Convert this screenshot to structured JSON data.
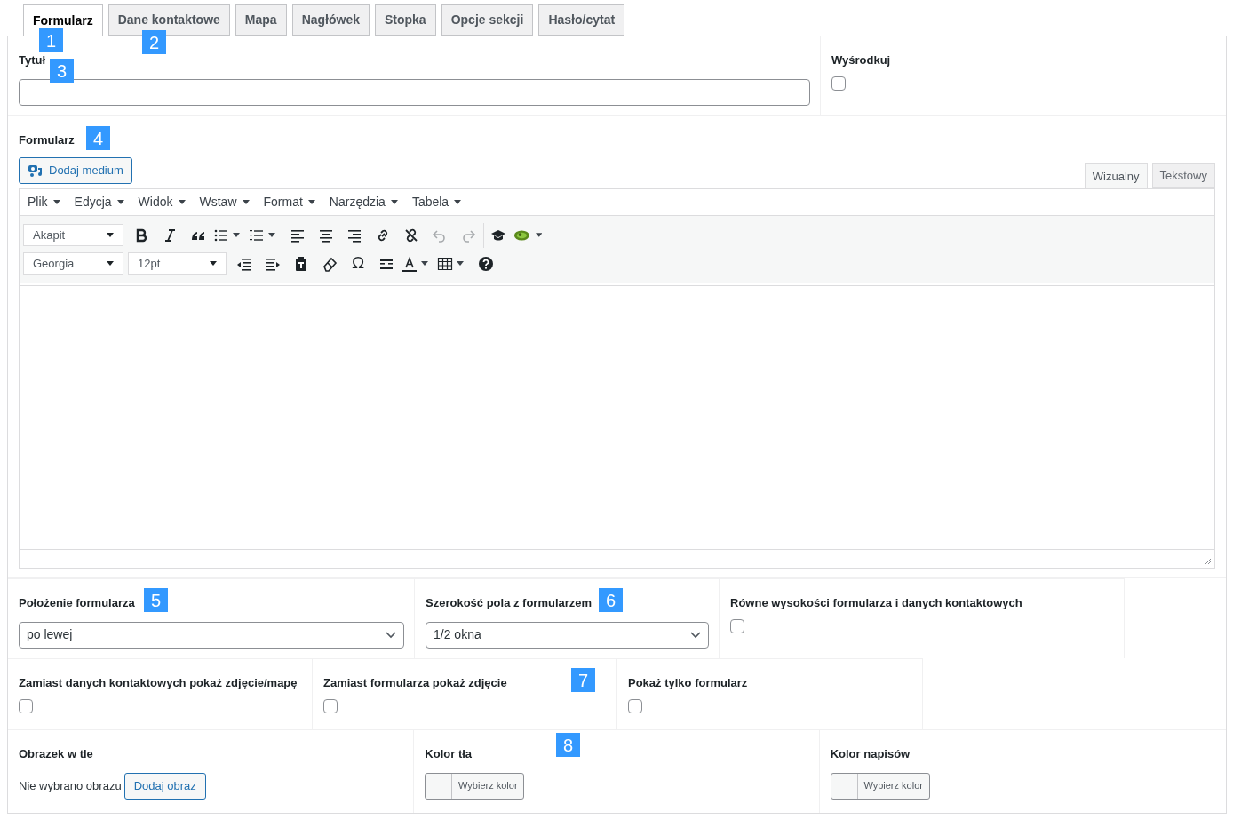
{
  "tabs": [
    {
      "label": "Formularz",
      "selected": true
    },
    {
      "label": "Dane kontaktowe",
      "selected": false
    },
    {
      "label": "Mapa",
      "selected": false
    },
    {
      "label": "Nagłówek",
      "selected": false
    },
    {
      "label": "Stopka",
      "selected": false
    },
    {
      "label": "Opcje sekcji",
      "selected": false
    },
    {
      "label": "Hasło/cytat",
      "selected": false
    }
  ],
  "title_field": {
    "label": "Tytuł"
  },
  "center": {
    "label": "Wyśrodkuj",
    "checked": false
  },
  "editor": {
    "label": "Formularz",
    "add_media": "Dodaj medium",
    "mode_tabs": [
      {
        "label": "Wizualny",
        "selected": true
      },
      {
        "label": "Tekstowy",
        "selected": false
      }
    ],
    "menus": [
      "Plik",
      "Edycja",
      "Widok",
      "Wstaw",
      "Format",
      "Narzędzia",
      "Tabela"
    ],
    "block_format": "Akapit",
    "font_family": "Georgia",
    "font_size": "12pt",
    "special_char": "Ω"
  },
  "row_selects": [
    {
      "kind": "select",
      "label": "Położenie formularza",
      "value": "po lewej"
    },
    {
      "kind": "select",
      "label": "Szerokość pola z formularzem",
      "value": "1/2 okna"
    },
    {
      "kind": "checkbox",
      "label": "Równe wysokości formularza i danych kontaktowych",
      "checked": false
    }
  ],
  "row_checks": [
    {
      "kind": "checkbox",
      "label": "Zamiast danych kontaktowych pokaż zdjęcie/mapę",
      "checked": false
    },
    {
      "kind": "checkbox",
      "label": "Zamiast formularza pokaż zdjęcie",
      "checked": false
    },
    {
      "kind": "checkbox",
      "label": "Pokaż tylko formularz",
      "checked": false
    }
  ],
  "row_media": [
    {
      "kind": "image",
      "label": "Obrazek w tle",
      "note": "Nie wybrano obrazu",
      "button": "Dodaj obraz"
    },
    {
      "kind": "color",
      "label": "Kolor tła",
      "button": "Wybierz kolor"
    },
    {
      "kind": "color",
      "label": "Kolor napisów",
      "button": "Wybierz kolor"
    }
  ],
  "annotations": [
    "1",
    "2",
    "3",
    "4",
    "5",
    "6",
    "7",
    "8"
  ]
}
